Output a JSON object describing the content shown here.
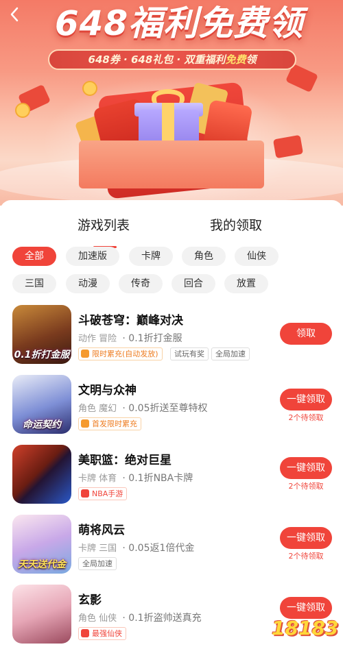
{
  "banner": {
    "back_icon": "chevron-left-icon",
    "headline": "648福利免费领",
    "ribbon_part1": "648券 · 648礼包 · 双重福利",
    "ribbon_highlight": "免费",
    "ribbon_part2": "领"
  },
  "tabs": [
    {
      "label": "游戏列表",
      "active": true
    },
    {
      "label": "我的领取",
      "active": false
    }
  ],
  "filters": [
    {
      "label": "全部",
      "active": true
    },
    {
      "label": "加速版"
    },
    {
      "label": "卡牌"
    },
    {
      "label": "角色"
    },
    {
      "label": "仙侠"
    },
    {
      "label": "三国"
    },
    {
      "label": "动漫"
    },
    {
      "label": "传奇"
    },
    {
      "label": "回合"
    },
    {
      "label": "放置"
    }
  ],
  "games": [
    {
      "title": "斗破苍穹：巅峰对决",
      "genres": "动作  冒险",
      "deal": "· 0.1折打金服",
      "thumb_caption": "0.1折打金服",
      "tags": [
        {
          "text": "限时累充(自动发放)",
          "style": "orange"
        },
        {
          "text": "试玩有奖"
        },
        {
          "text": "全局加速"
        }
      ],
      "button": "领取",
      "pending": ""
    },
    {
      "title": "文明与众神",
      "genres": "角色  魔幻",
      "deal": "· 0.05折送至尊特权",
      "thumb_caption": "命运契约",
      "tags": [
        {
          "text": "首发限时累充",
          "style": "orange"
        }
      ],
      "button": "一键领取",
      "pending": "2个待领取"
    },
    {
      "title": "美职篮：绝对巨星",
      "genres": "卡牌  体育",
      "deal": "· 0.1折NBA卡牌",
      "thumb_caption": "",
      "tags": [
        {
          "text": "NBA手游",
          "style": "hot"
        }
      ],
      "button": "一键领取",
      "pending": "2个待领取"
    },
    {
      "title": "萌将风云",
      "genres": "卡牌  三国",
      "deal": "· 0.05返1倍代金",
      "thumb_caption": "天天送代金",
      "tags": [
        {
          "text": "全局加速"
        }
      ],
      "button": "一键领取",
      "pending": "2个待领取"
    },
    {
      "title": "玄影",
      "genres": "角色  仙侠",
      "deal": "· 0.1折盗帅送真充",
      "thumb_caption": "",
      "tags": [
        {
          "text": "最强仙侠",
          "style": "hot"
        }
      ],
      "button": "一键领取",
      "pending": ""
    }
  ],
  "watermark": "18183",
  "colors": {
    "accent": "#f0443a",
    "chip_bg": "#f2f2f2"
  }
}
